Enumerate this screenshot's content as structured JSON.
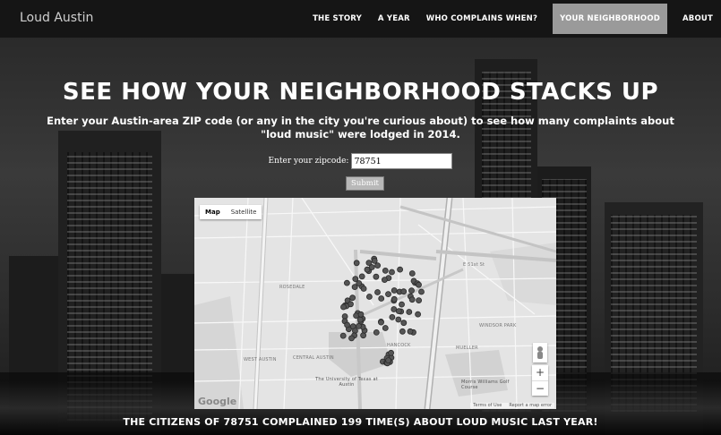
{
  "navbar": {
    "brand": "Loud Austin",
    "items": [
      {
        "label": "THE STORY"
      },
      {
        "label": "A YEAR"
      },
      {
        "label": "WHO COMPLAINS WHEN?"
      },
      {
        "label": "YOUR NEIGHBORHOOD",
        "active": true
      },
      {
        "label": "ABOUT"
      }
    ]
  },
  "main": {
    "headline": "SEE HOW YOUR NEIGHBORHOOD STACKS UP",
    "intro": "Enter your Austin-area ZIP code (or any in the city you're curious about) to see how many complaints about \"loud music\" were lodged in 2014.",
    "zip_label": "Enter your zipcode:",
    "zip_value": "78751",
    "submit_label": "Submit",
    "result": "THE CITIZENS OF 78751 COMPLAINED 199 TIME(S) ABOUT LOUD MUSIC LAST YEAR!"
  },
  "map": {
    "type_options": [
      "Map",
      "Satellite"
    ],
    "selected_type": "Map",
    "zoom_in": "+",
    "zoom_out": "−",
    "logo": "Google",
    "footer": [
      "Terms of Use",
      "Report a map error"
    ],
    "labels": {
      "rosedale": "ROSEDALE",
      "central_austin": "CENTRAL AUSTIN",
      "hancock": "HANCOCK",
      "windsor_park": "WINDSOR PARK",
      "mueller": "MUELLER",
      "west_austin": "WEST AUSTIN",
      "university": "The University of Texas at Austin",
      "golf_course": "Morris Williams Golf Course",
      "east_51st": "E 51st St"
    },
    "marker_color": "#555555"
  }
}
